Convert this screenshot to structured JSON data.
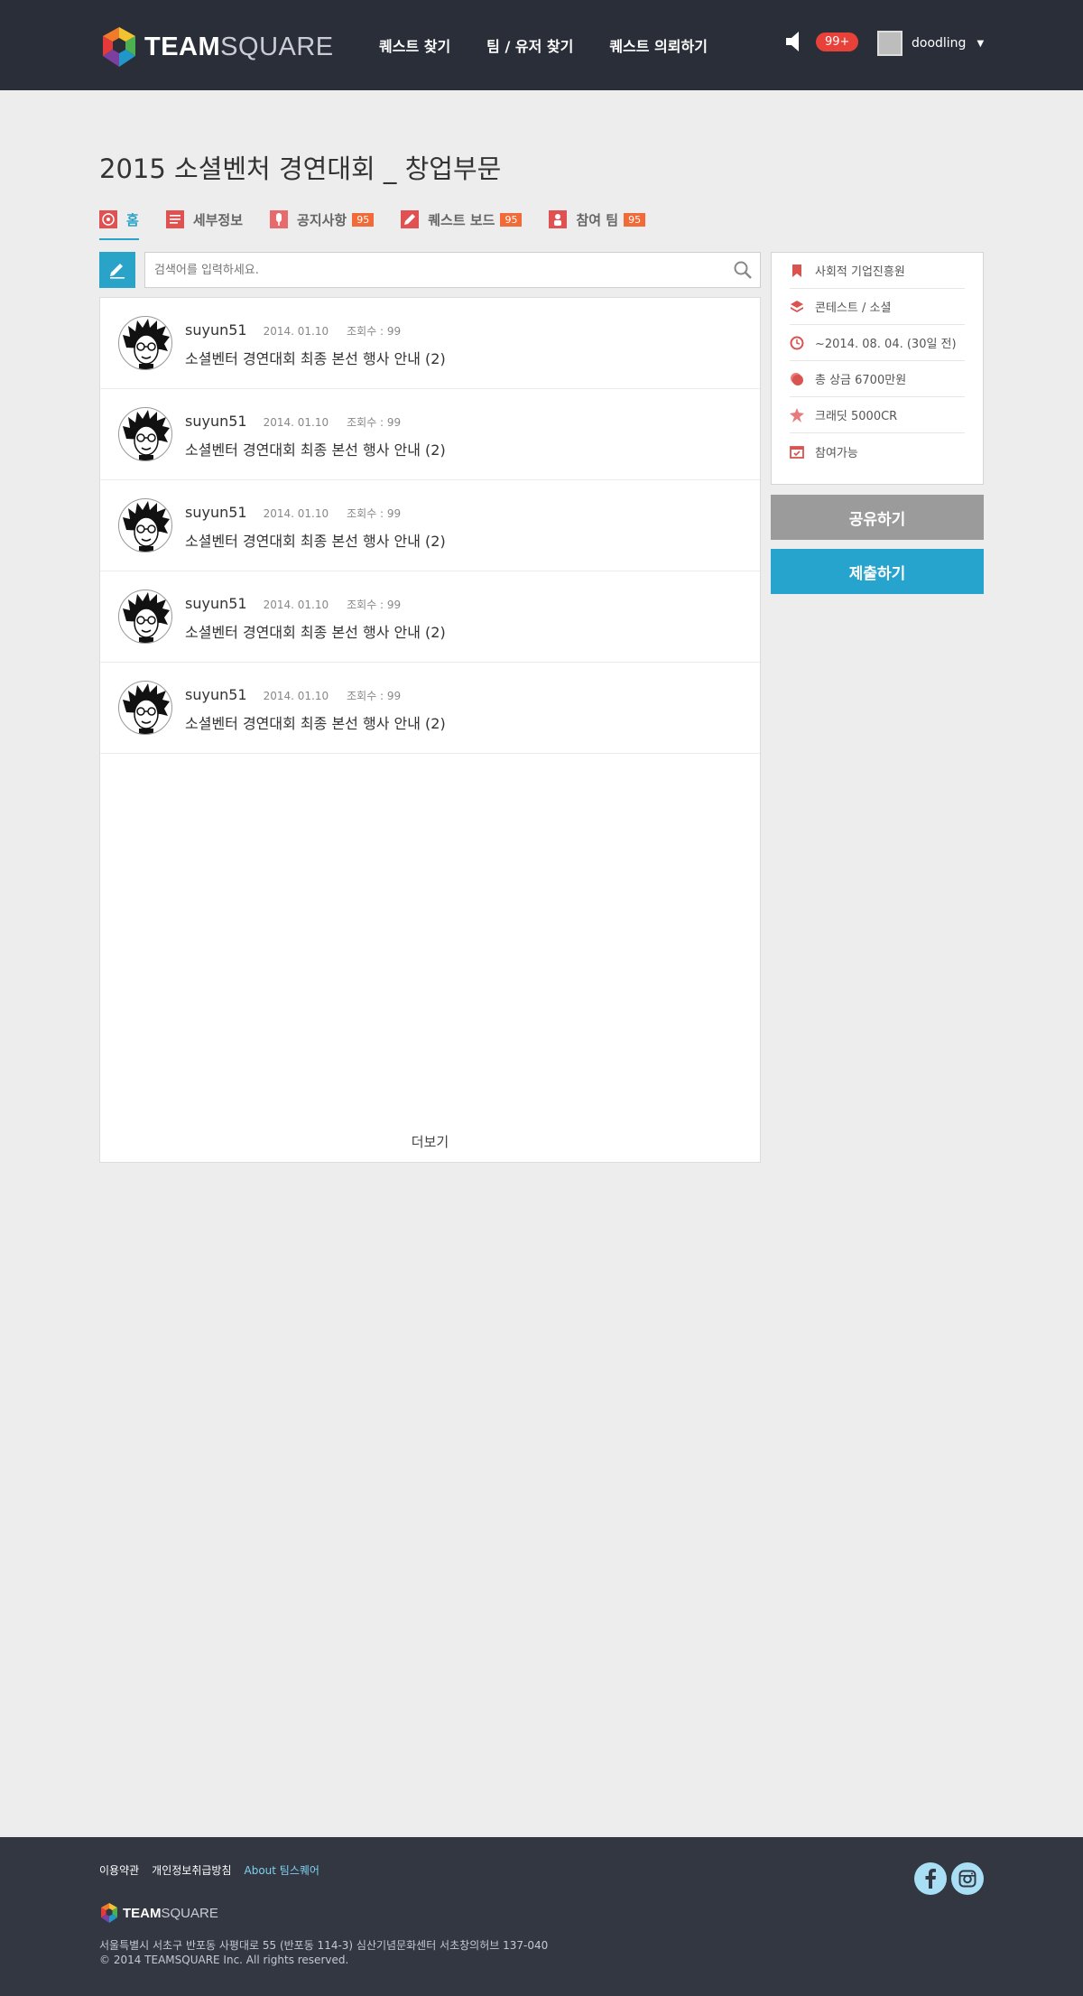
{
  "header": {
    "logo": {
      "bold": "TEAM",
      "light": "SQUARE"
    },
    "nav": [
      "퀘스트 찾기",
      "팀 / 유저 찾기",
      "퀘스트 의뢰하기"
    ],
    "notification_count": "99+",
    "username": "doodling",
    "icons": {
      "notification": "speaker-icon",
      "caret": "chevron-down-icon"
    }
  },
  "page": {
    "title": "2015 소셜벤처 경연대회 _ 창업부문",
    "tabs": [
      {
        "label": "홈",
        "count": "",
        "icon": "target-icon",
        "active": true
      },
      {
        "label": "세부정보",
        "count": "",
        "icon": "document-icon"
      },
      {
        "label": "공지사항",
        "count": "95",
        "icon": "microphone-icon"
      },
      {
        "label": "퀘스트 보드",
        "count": "95",
        "icon": "pencil-board-icon"
      },
      {
        "label": "참여 팀",
        "count": "95",
        "icon": "people-icon"
      }
    ]
  },
  "search": {
    "placeholder": "검색어를 입력하세요.",
    "value": ""
  },
  "posts": [
    {
      "author": "suyun51",
      "date": "2014. 01.10",
      "views": "조회수 : 99",
      "title": "소셜벤터 경연대회  최종 본선 행사 안내 (2)"
    },
    {
      "author": "suyun51",
      "date": "2014. 01.10",
      "views": "조회수 : 99",
      "title": "소셜벤터 경연대회  최종 본선 행사 안내 (2)"
    },
    {
      "author": "suyun51",
      "date": "2014. 01.10",
      "views": "조회수 : 99",
      "title": "소셜벤터 경연대회  최종 본선 행사 안내 (2)"
    },
    {
      "author": "suyun51",
      "date": "2014. 01.10",
      "views": "조회수 : 99",
      "title": "소셜벤터 경연대회  최종 본선 행사 안내 (2)"
    },
    {
      "author": "suyun51",
      "date": "2014. 01.10",
      "views": "조회수 : 99",
      "title": "소셜벤터 경연대회  최종 본선 행사 안내 (2)"
    }
  ],
  "more_label": "더보기",
  "info": [
    {
      "icon": "bookmark-icon",
      "text": "사회적 기업진흥원"
    },
    {
      "icon": "layers-icon",
      "text": "콘테스트 / 소셜"
    },
    {
      "icon": "clock-icon",
      "text": "~2014. 08. 04. (30일 전)"
    },
    {
      "icon": "coin-icon",
      "text": "총 상금 6700만원"
    },
    {
      "icon": "star-badge-icon",
      "text": "크래딧 5000CR"
    },
    {
      "icon": "calendar-check-icon",
      "text": "참여가능"
    }
  ],
  "actions": {
    "share": "공유하기",
    "submit": "제출하기"
  },
  "footer": {
    "links": [
      "이용약관",
      "개인정보취급방침",
      "About 팀스퀘어"
    ],
    "logo": {
      "bold": "TEAM",
      "light": "SQUARE"
    },
    "address": "서울특별시 서초구 반포동 사평대로 55 (반포동 114-3) 심산기념문화센터 서초창의허브 137-040",
    "copyright": "© 2014 TEAMSQUARE Inc. All rights reserved.",
    "social": [
      "facebook-icon",
      "instagram-icon"
    ]
  },
  "colors": {
    "accent": "#2aa3c9",
    "header_bg": "#2a2e38",
    "badge_red": "#e8413a",
    "count_orange": "#f26a38",
    "footer_bg": "#323742",
    "share_gray": "#9b9b9b",
    "icon_red": "#e05252"
  }
}
